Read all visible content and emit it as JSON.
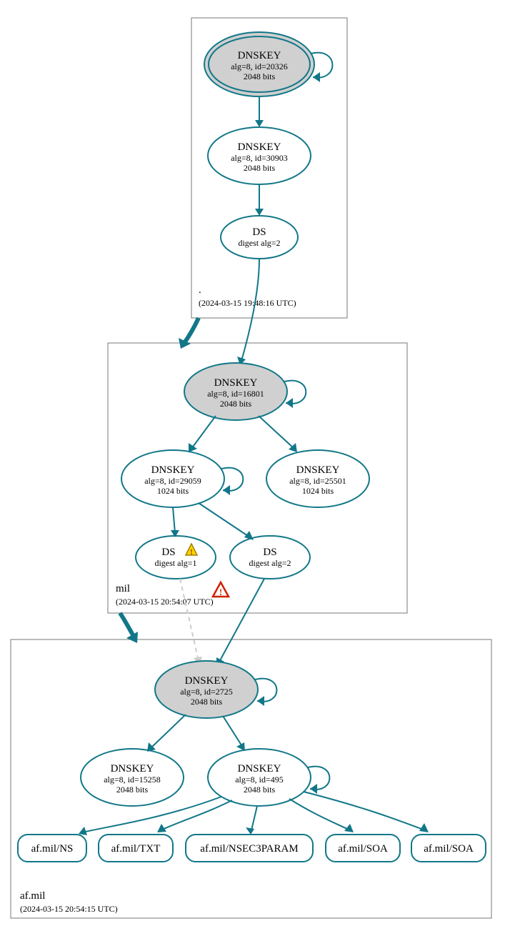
{
  "zones": {
    "root": {
      "label": ".",
      "timestamp": "(2024-03-15 19:48:16 UTC)"
    },
    "mil": {
      "label": "mil",
      "timestamp": "(2024-03-15 20:54:07 UTC)"
    },
    "afmil": {
      "label": "af.mil",
      "timestamp": "(2024-03-15 20:54:15 UTC)"
    }
  },
  "nodes": {
    "root_ksk": {
      "title": "DNSKEY",
      "line1": "alg=8, id=20326",
      "line2": "2048 bits"
    },
    "root_zsk": {
      "title": "DNSKEY",
      "line1": "alg=8, id=30903",
      "line2": "2048 bits"
    },
    "root_ds": {
      "title": "DS",
      "line1": "digest alg=2"
    },
    "mil_ksk": {
      "title": "DNSKEY",
      "line1": "alg=8, id=16801",
      "line2": "2048 bits"
    },
    "mil_zsk1": {
      "title": "DNSKEY",
      "line1": "alg=8, id=29059",
      "line2": "1024 bits"
    },
    "mil_zsk2": {
      "title": "DNSKEY",
      "line1": "alg=8, id=25501",
      "line2": "1024 bits"
    },
    "mil_ds1": {
      "title": "DS",
      "line1": "digest alg=1"
    },
    "mil_ds2": {
      "title": "DS",
      "line1": "digest alg=2"
    },
    "af_ksk": {
      "title": "DNSKEY",
      "line1": "alg=8, id=2725",
      "line2": "2048 bits"
    },
    "af_zsk1": {
      "title": "DNSKEY",
      "line1": "alg=8, id=15258",
      "line2": "2048 bits"
    },
    "af_zsk2": {
      "title": "DNSKEY",
      "line1": "alg=8, id=495",
      "line2": "2048 bits"
    }
  },
  "rrsets": {
    "ns": "af.mil/NS",
    "txt": "af.mil/TXT",
    "nsec3": "af.mil/NSEC3PARAM",
    "soa1": "af.mil/SOA",
    "soa2": "af.mil/SOA"
  },
  "icons": {
    "warn_yellow": "⚠",
    "warn_red": "⚠"
  }
}
